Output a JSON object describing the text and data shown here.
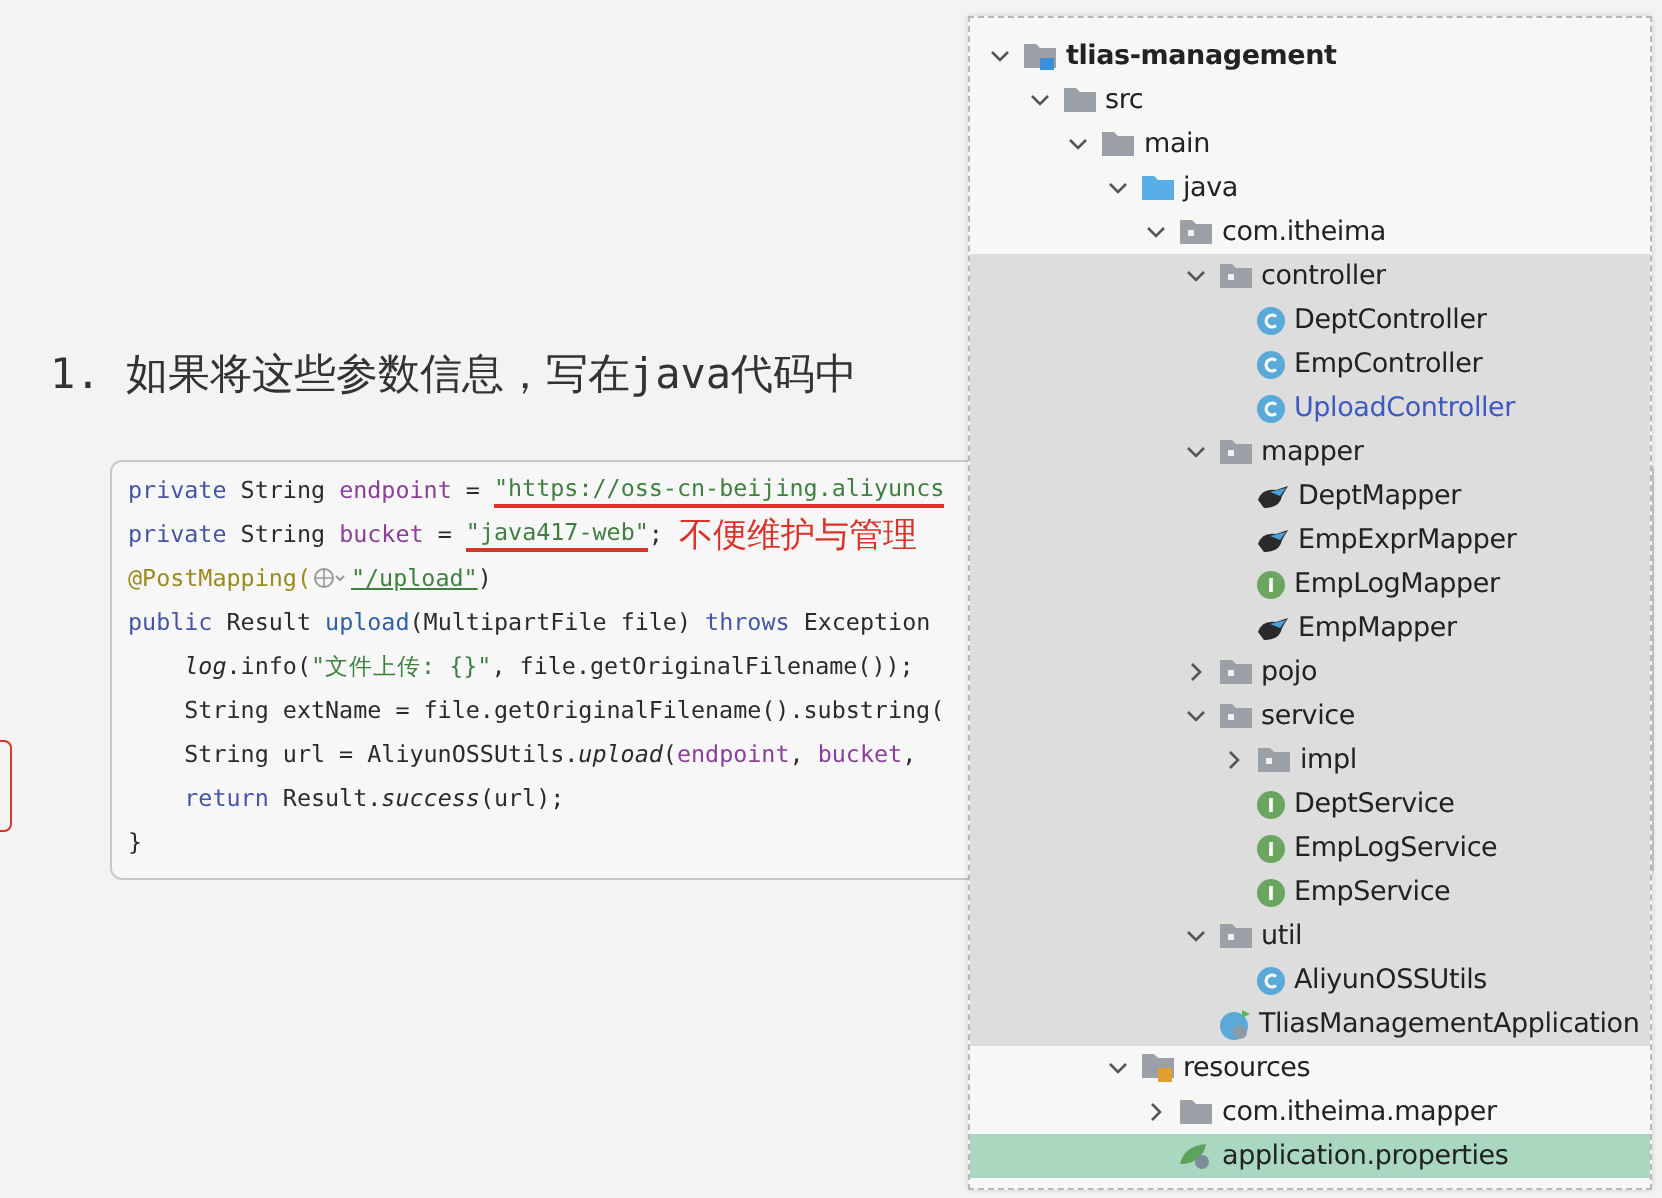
{
  "heading": "1. 如果将这些参数信息，写在java代码中",
  "code_lines": [
    {
      "tokens": [
        {
          "kind": "keyword",
          "text": "private "
        },
        {
          "kind": "plain",
          "text": "String "
        },
        {
          "kind": "field",
          "text": "endpoint"
        },
        {
          "kind": "plain",
          "text": " = "
        },
        {
          "kind": "string",
          "text": "\"https://oss-cn-beijing.aliyuncs",
          "flagged": true
        }
      ]
    },
    {
      "tokens": [
        {
          "kind": "keyword",
          "text": "private "
        },
        {
          "kind": "plain",
          "text": "String "
        },
        {
          "kind": "field",
          "text": "bucket"
        },
        {
          "kind": "plain",
          "text": " = "
        },
        {
          "kind": "string",
          "text": "\"java417-web\"",
          "flagged": true
        },
        {
          "kind": "plain",
          "text": ";"
        }
      ],
      "note": "不便维护与管理"
    },
    {
      "tokens": [
        {
          "kind": "annotation",
          "text": "@PostMapping("
        },
        {
          "kind": "inlay"
        },
        {
          "kind": "link",
          "text": "\"/upload\""
        },
        {
          "kind": "plain",
          "text": ")"
        }
      ]
    },
    {
      "tokens": [
        {
          "kind": "keyword",
          "text": "public "
        },
        {
          "kind": "plain",
          "text": "Result "
        },
        {
          "kind": "method",
          "text": "upload"
        },
        {
          "kind": "plain",
          "text": "(MultipartFile file) "
        },
        {
          "kind": "keyword",
          "text": "throws "
        },
        {
          "kind": "plain",
          "text": "Exception"
        }
      ]
    },
    {
      "tokens": [
        {
          "kind": "static",
          "text": "    log"
        },
        {
          "kind": "plain",
          "text": ".info("
        },
        {
          "kind": "string",
          "text": "\"文件上传: {}\""
        },
        {
          "kind": "plain",
          "text": ", file.getOriginalFilename());"
        }
      ]
    },
    {
      "tokens": [
        {
          "kind": "plain",
          "text": "    String extName = file.getOriginalFilename().substring("
        }
      ]
    },
    {
      "tokens": [
        {
          "kind": "plain",
          "text": "    String url = AliyunOSSUtils."
        },
        {
          "kind": "static",
          "text": "upload"
        },
        {
          "kind": "plain",
          "text": "("
        },
        {
          "kind": "field",
          "text": "endpoint"
        },
        {
          "kind": "plain",
          "text": ", "
        },
        {
          "kind": "field",
          "text": "bucket"
        },
        {
          "kind": "plain",
          "text": ", "
        }
      ]
    },
    {
      "tokens": [
        {
          "kind": "keyword",
          "text": "    return "
        },
        {
          "kind": "plain",
          "text": "Result."
        },
        {
          "kind": "static",
          "text": "success"
        },
        {
          "kind": "plain",
          "text": "(url);"
        }
      ]
    },
    {
      "tokens": [
        {
          "kind": "plain",
          "text": "}"
        }
      ]
    }
  ],
  "project_tree": [
    {
      "label": "tlias-management",
      "kind": "module",
      "expanded": true,
      "selected": false,
      "children": [
        {
          "label": "src",
          "kind": "folder",
          "expanded": true,
          "selected": false,
          "children": [
            {
              "label": "main",
              "kind": "folder",
              "expanded": true,
              "selected": false,
              "children": [
                {
                  "label": "java",
                  "kind": "source",
                  "expanded": true,
                  "selected": false,
                  "children": [
                    {
                      "label": "com.itheima",
                      "kind": "package",
                      "expanded": true,
                      "selected": false,
                      "children": [
                        {
                          "label": "controller",
                          "kind": "package",
                          "expanded": true,
                          "selected": false,
                          "shaded": true,
                          "children": [
                            {
                              "label": "DeptController",
                              "kind": "class",
                              "selected": false
                            },
                            {
                              "label": "EmpController",
                              "kind": "class",
                              "selected": false
                            },
                            {
                              "label": "UploadController",
                              "kind": "class",
                              "selected": false,
                              "changed": true
                            }
                          ]
                        },
                        {
                          "label": "mapper",
                          "kind": "package",
                          "expanded": true,
                          "selected": false,
                          "shaded": true,
                          "children": [
                            {
                              "label": "DeptMapper",
                              "kind": "mapper",
                              "selected": false
                            },
                            {
                              "label": "EmpExprMapper",
                              "kind": "mapper",
                              "selected": false
                            },
                            {
                              "label": "EmpLogMapper",
                              "kind": "interface",
                              "selected": false
                            },
                            {
                              "label": "EmpMapper",
                              "kind": "mapper",
                              "selected": false
                            }
                          ]
                        },
                        {
                          "label": "pojo",
                          "kind": "package",
                          "expanded": false,
                          "selected": false,
                          "shaded": true
                        },
                        {
                          "label": "service",
                          "kind": "package",
                          "expanded": true,
                          "selected": false,
                          "shaded": true,
                          "children": [
                            {
                              "label": "impl",
                              "kind": "package",
                              "expanded": false,
                              "selected": false
                            },
                            {
                              "label": "DeptService",
                              "kind": "interface",
                              "selected": false
                            },
                            {
                              "label": "EmpLogService",
                              "kind": "interface",
                              "selected": false
                            },
                            {
                              "label": "EmpService",
                              "kind": "interface",
                              "selected": false
                            }
                          ]
                        },
                        {
                          "label": "util",
                          "kind": "package",
                          "expanded": true,
                          "selected": false,
                          "shaded": true,
                          "children": [
                            {
                              "label": "AliyunOSSUtils",
                              "kind": "class",
                              "selected": false
                            }
                          ]
                        },
                        {
                          "label": "TliasManagementApplication",
                          "kind": "app",
                          "selected": false,
                          "shaded": true
                        }
                      ]
                    }
                  ]
                },
                {
                  "label": "resources",
                  "kind": "resources",
                  "expanded": true,
                  "selected": false,
                  "children": [
                    {
                      "label": "com.itheima.mapper",
                      "kind": "folder",
                      "expanded": false,
                      "selected": false
                    },
                    {
                      "label": "application.properties",
                      "kind": "properties",
                      "selected": true
                    }
                  ]
                }
              ]
            }
          ]
        }
      ]
    }
  ]
}
